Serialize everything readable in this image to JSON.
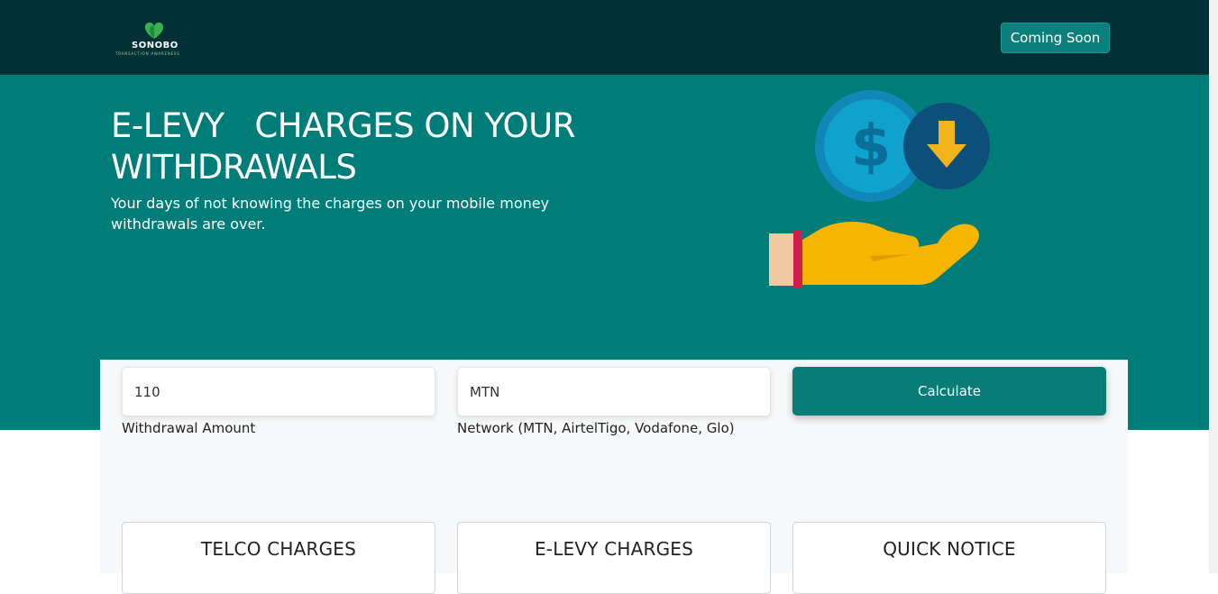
{
  "brand": {
    "name": "SONOBO",
    "tagline": "TRANSACTION AWARENESS"
  },
  "header": {
    "cta_label": "Coming Soon"
  },
  "hero": {
    "title": "E-LEVY   CHARGES ON YOUR WITHDRAWALS",
    "subtitle": "Your days of not knowing the charges on your mobile money withdrawals are over."
  },
  "form": {
    "amount": {
      "value": "110",
      "label": "Withdrawal Amount"
    },
    "network": {
      "value": "MTN",
      "label": "Network (MTN, AirtelTigo, Vodafone, Glo)"
    },
    "calculate_label": "Calculate"
  },
  "cards": [
    {
      "title": "TELCO CHARGES"
    },
    {
      "title": "E-LEVY CHARGES"
    },
    {
      "title": "QUICK NOTICE"
    }
  ],
  "colors": {
    "navbar": "#013136",
    "hero": "#007d78",
    "button": "#087d78",
    "coin": "#0a9fc4",
    "hand": "#f7b500"
  },
  "icons": {
    "logo": "heart-logo-icon",
    "illustration": "coin-withdraw-hand-icon"
  }
}
